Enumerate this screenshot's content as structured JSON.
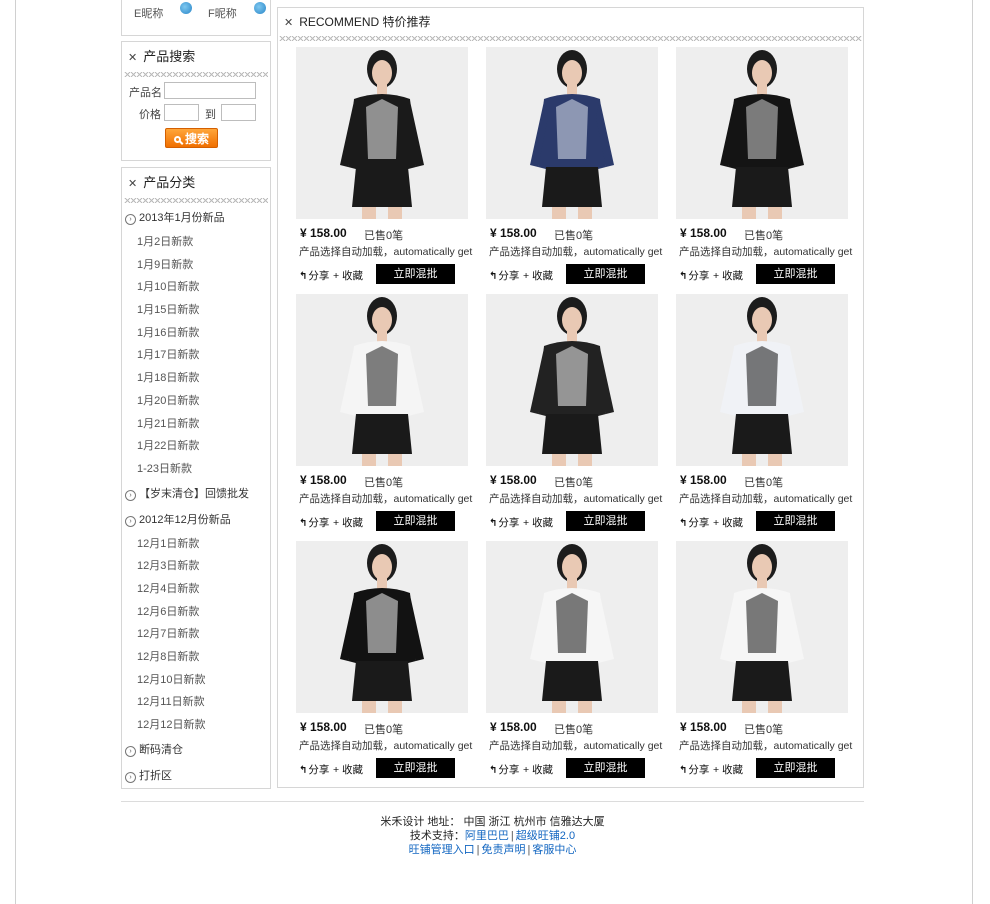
{
  "sidebar": {
    "contacts": [
      {
        "label": "E昵称"
      },
      {
        "label": "F昵称"
      }
    ],
    "search": {
      "title": "产品搜索",
      "name_label": "产品名",
      "name_value": "",
      "price_label": "价格",
      "price_from": "",
      "to_label": "到",
      "price_to": "",
      "button_label": "搜索"
    },
    "categories": {
      "title": "产品分类",
      "groups": [
        {
          "label": "2013年1月份新品",
          "items": [
            "1月2日新款",
            "1月9日新款",
            "1月10日新款",
            "1月15日新款",
            "1月16日新款",
            "1月17日新款",
            "1月18日新款",
            "1月20日新款",
            "1月21日新款",
            "1月22日新款",
            "1-23日新款"
          ]
        },
        {
          "label": "【岁末清仓】回馈批发",
          "items": []
        },
        {
          "label": "2012年12月份新品",
          "items": [
            "12月1日新款",
            "12月3日新款",
            "12月4日新款",
            "12月6日新款",
            "12月7日新款",
            "12月8日新款",
            "12月10日新款",
            "12月11日新款",
            "12月12日新款"
          ]
        },
        {
          "label": "断码清仓",
          "items": []
        },
        {
          "label": "打折区",
          "items": []
        }
      ]
    }
  },
  "main": {
    "title": "RECOMMEND 特价推荐",
    "products": [
      {
        "price": "¥ 158.00",
        "sold": "已售0笔",
        "desc": "产品选择自动加载，automatically get",
        "share": "分享",
        "fav": "+ 收藏",
        "buy": "立即混批",
        "image": "striped-blazer",
        "colors": [
          "#1a1a1a",
          "#f2f2f2"
        ]
      },
      {
        "price": "¥ 158.00",
        "sold": "已售0笔",
        "desc": "产品选择自动加载，automatically get",
        "share": "分享",
        "fav": "+ 收藏",
        "buy": "立即混批",
        "image": "navy-plaid-shirt",
        "colors": [
          "#2b3a6b",
          "#dfe3ee"
        ]
      },
      {
        "price": "¥ 158.00",
        "sold": "已售0笔",
        "desc": "产品选择自动加载，automatically get",
        "share": "分享",
        "fav": "+ 收藏",
        "buy": "立即混批",
        "image": "black-lace-top",
        "colors": [
          "#141414",
          "#cfcfcf"
        ]
      },
      {
        "price": "¥ 158.00",
        "sold": "已售0笔",
        "desc": "产品选择自动加载，automatically get",
        "share": "分享",
        "fav": "+ 收藏",
        "buy": "立即混批",
        "image": "white-print-top",
        "colors": [
          "#f5f5f5",
          "#1a1a1a"
        ]
      },
      {
        "price": "¥ 158.00",
        "sold": "已售0笔",
        "desc": "产品选择自动加载，automatically get",
        "share": "分享",
        "fav": "+ 收藏",
        "buy": "立即混批",
        "image": "letter-print-sweater",
        "colors": [
          "#222",
          "#f4f4f4"
        ]
      },
      {
        "price": "¥ 158.00",
        "sold": "已售0笔",
        "desc": "产品选择自动加载，automatically get",
        "share": "分享",
        "fav": "+ 收藏",
        "buy": "立即混批",
        "image": "bird-print-blouse",
        "colors": [
          "#f0f2f6",
          "#111"
        ]
      },
      {
        "price": "¥ 158.00",
        "sold": "已售0笔",
        "desc": "产品选择自动加载，automatically get",
        "share": "分享",
        "fav": "+ 收藏",
        "buy": "立即混批",
        "image": "black-pleated-blouse",
        "colors": [
          "#121212",
          "#f2f2f2"
        ]
      },
      {
        "price": "¥ 158.00",
        "sold": "已售0笔",
        "desc": "产品选择自动加载，automatically get",
        "share": "分享",
        "fav": "+ 收藏",
        "buy": "立即混批",
        "image": "polka-dot-dress",
        "colors": [
          "#f6f6f6",
          "#111"
        ]
      },
      {
        "price": "¥ 158.00",
        "sold": "已售0笔",
        "desc": "产品选择自动加载，automatically get",
        "share": "分享",
        "fav": "+ 收藏",
        "buy": "立即混批",
        "image": "polka-dot-blouse",
        "colors": [
          "#f6f6f6",
          "#111"
        ]
      }
    ]
  },
  "footer": {
    "line1": "米禾设计 地址：  中国 浙江 杭州市 信雅达大厦",
    "support_label": "技术支持：",
    "support_link1": "阿里巴巴",
    "support_link2": "超级旺铺2.0",
    "links": [
      "旺铺管理入口",
      "免责声明",
      "客服中心"
    ]
  }
}
